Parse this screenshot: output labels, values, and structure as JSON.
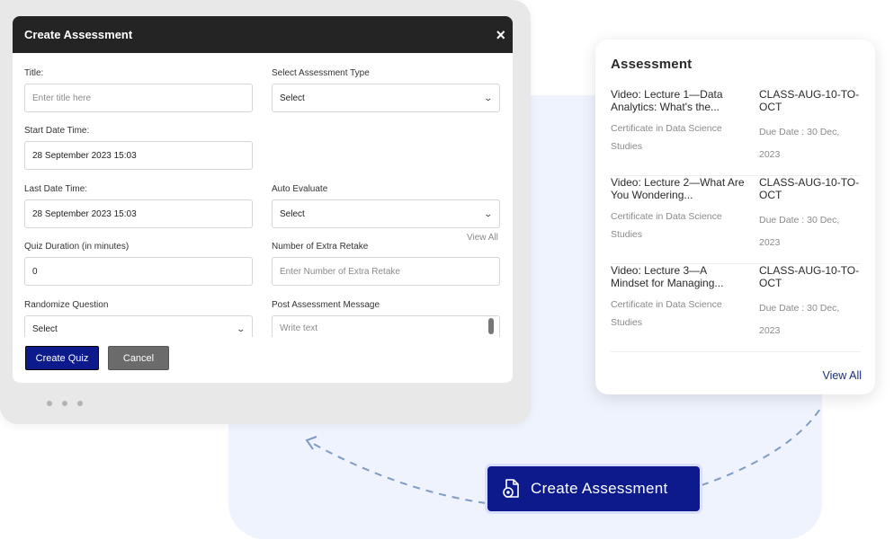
{
  "modal": {
    "title": "Create Assessment",
    "close_label": "×",
    "fields": {
      "title": {
        "label": "Title:",
        "placeholder": "Enter title here"
      },
      "type": {
        "label": "Select Assessment Type",
        "value": "Select"
      },
      "start": {
        "label": "Start Date Time:",
        "value": "28 September 2023 15:03"
      },
      "last": {
        "label": "Last Date Time:",
        "value": "28 September 2023 15:03"
      },
      "auto": {
        "label": "Auto Evaluate",
        "value": "Select"
      },
      "duration": {
        "label": "Quiz Duration (in minutes)",
        "value": "0"
      },
      "retake": {
        "label": "Number of Extra Retake",
        "placeholder": "Enter Number of Extra Retake"
      },
      "randomize": {
        "label": "Randomize Question",
        "value": "Select"
      },
      "post": {
        "label": "Post Assessment Message",
        "placeholder": "Write text"
      }
    },
    "view_all": "View All",
    "create_button": "Create Quiz",
    "cancel_button": "Cancel"
  },
  "assessment_card": {
    "title": "Assessment",
    "items": [
      {
        "title": "Video: Lecture 1—Data Analytics: What's the...",
        "course": "Certificate in Data Science Studies",
        "class": "CLASS-AUG-10-TO-OCT",
        "due": "Due Date : 30 Dec, 2023"
      },
      {
        "title": "Video: Lecture 2—What Are You Wondering...",
        "course": "Certificate in Data Science Studies",
        "class": "CLASS-AUG-10-TO-OCT",
        "due": "Due Date : 30 Dec, 2023"
      },
      {
        "title": "Video: Lecture 3—A Mindset for Managing...",
        "course": "Certificate in Data Science Studies",
        "class": "CLASS-AUG-10-TO-OCT",
        "due": "Due Date : 30 Dec, 2023"
      }
    ],
    "view_all": "View All"
  },
  "cta": {
    "label": "Create Assessment",
    "icon": "document-gear-icon"
  },
  "colors": {
    "primary": "#0c1a8c",
    "header": "#242424",
    "panel_bg": "#eef3fd",
    "frame_bg": "#e8e8e8"
  }
}
